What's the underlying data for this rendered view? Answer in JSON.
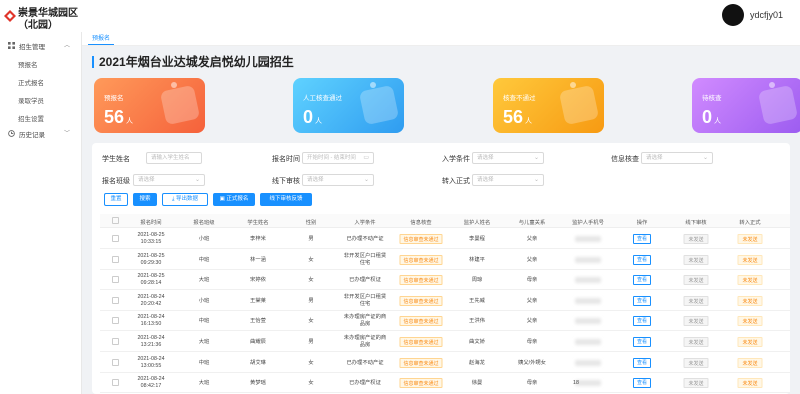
{
  "app": {
    "title": "崇景华城园区（北园）",
    "username": "ydcfjy01"
  },
  "sidebar": {
    "groups": [
      {
        "label": "招生管理",
        "expanded": true,
        "items": [
          "预报名",
          "正式报名",
          "录取学员",
          "招生设置"
        ]
      },
      {
        "label": "历史记录",
        "expanded": false,
        "items": []
      }
    ]
  },
  "tabs": [
    "预报名"
  ],
  "page_title": "2021年烟台业达城发启悦幼儿园招生",
  "cards": [
    {
      "label": "预报名",
      "value": "56",
      "unit": "人",
      "color": "#f7734a"
    },
    {
      "label": "人工核查通过",
      "value": "0",
      "unit": "人",
      "color": "#3fb4f5"
    },
    {
      "label": "核查不通过",
      "value": "56",
      "unit": "人",
      "color": "#f8a51c"
    },
    {
      "label": "待核查",
      "value": "0",
      "unit": "人",
      "color": "#b46cf0"
    }
  ],
  "filters": {
    "student_name": {
      "label": "学生姓名",
      "placeholder": "请输入学生姓名"
    },
    "signup_time": {
      "label": "报名时间",
      "placeholder": "开始时间 - 结束时间"
    },
    "admission": {
      "label": "入学条件",
      "placeholder": "请选择"
    },
    "info_check": {
      "label": "信息核查",
      "placeholder": "请选择"
    },
    "signup_class": {
      "label": "报名班级",
      "placeholder": "请选择"
    },
    "offline_review": {
      "label": "线下审核",
      "placeholder": "请选择"
    },
    "formal_transfer": {
      "label": "转入正式",
      "placeholder": "请选择"
    }
  },
  "buttons": {
    "reset": "重置",
    "search": "搜索",
    "export": "导出数据",
    "formal": "正式报名",
    "offline": "线下审核反馈"
  },
  "table": {
    "headers": [
      "报名时间",
      "报名班级",
      "学生姓名",
      "性别",
      "入学条件",
      "信息核查",
      "监护人姓名",
      "与儿童关系",
      "监护人手机号",
      "操作",
      "线下审核",
      "转入正式"
    ],
    "rows": [
      {
        "time": [
          "2021-08-25",
          "10:33:15"
        ],
        "cls": "小班",
        "name": "李梓米",
        "gender": "男",
        "cond": [
          "已办理不动产证"
        ],
        "check": "信息审查未通过",
        "guardian": "李曼程",
        "relation": "父亲",
        "op": "查看",
        "offline": "未发送",
        "formal": "未发送"
      },
      {
        "time": [
          "2021-08-25",
          "09:29:30"
        ],
        "cls": "中班",
        "name": "林一涵",
        "gender": "女",
        "cond": [
          "非开发区户口租赁",
          "住宅"
        ],
        "check": "信息审查未通过",
        "guardian": "林建平",
        "relation": "父亲",
        "op": "查看",
        "offline": "未发送",
        "formal": "未发送"
      },
      {
        "time": [
          "2021-08-25",
          "09:28:14"
        ],
        "cls": "大班",
        "name": "宋婷依",
        "gender": "女",
        "cond": [
          "已办理产权证"
        ],
        "check": "信息审查未通过",
        "guardian": "周琼",
        "relation": "母亲",
        "op": "查看",
        "offline": "未发送",
        "formal": "未发送"
      },
      {
        "time": [
          "2021-08-24",
          "20:20:42"
        ],
        "cls": "小班",
        "name": "王棠莱",
        "gender": "男",
        "cond": [
          "非开发区户口租赁",
          "住宅"
        ],
        "check": "信息审查未通过",
        "guardian": "王先威",
        "relation": "父亲",
        "op": "查看",
        "offline": "未发送",
        "formal": "未发送"
      },
      {
        "time": [
          "2021-08-24",
          "16:13:50"
        ],
        "cls": "中班",
        "name": "王怡萱",
        "gender": "女",
        "cond": [
          "未办理房产证的商",
          "品房"
        ],
        "check": "信息审查未通过",
        "guardian": "王洪伟",
        "relation": "父亲",
        "op": "查看",
        "offline": "未发送",
        "formal": "未发送"
      },
      {
        "time": [
          "2021-08-24",
          "13:21:36"
        ],
        "cls": "大班",
        "name": "曲耀辰",
        "gender": "男",
        "cond": [
          "未办理房产证的商",
          "品房"
        ],
        "check": "信息审查未通过",
        "guardian": "曲文娇",
        "relation": "母亲",
        "op": "查看",
        "offline": "未发送",
        "formal": "未发送"
      },
      {
        "time": [
          "2021-08-24",
          "13:00:55"
        ],
        "cls": "中班",
        "name": "胡艾琳",
        "gender": "女",
        "cond": [
          "已办理不动产证"
        ],
        "check": "信息审查未通过",
        "guardian": "赵海龙",
        "relation": "姨父/外甥女",
        "op": "查看",
        "offline": "未发送",
        "formal": "未发送"
      },
      {
        "time": [
          "2021-08-24",
          "08:42:17"
        ],
        "cls": "大班",
        "name": "黄梦瑶",
        "gender": "女",
        "cond": [
          "已办理产权证"
        ],
        "check": "信息审查未通过",
        "guardian": "徐曼",
        "relation": "母亲",
        "op": "查看",
        "offline": "未发送",
        "formal": "未发送"
      }
    ]
  },
  "phone_partial": [
    "",
    "",
    "",
    "",
    "",
    "",
    "",
    "18"
  ]
}
